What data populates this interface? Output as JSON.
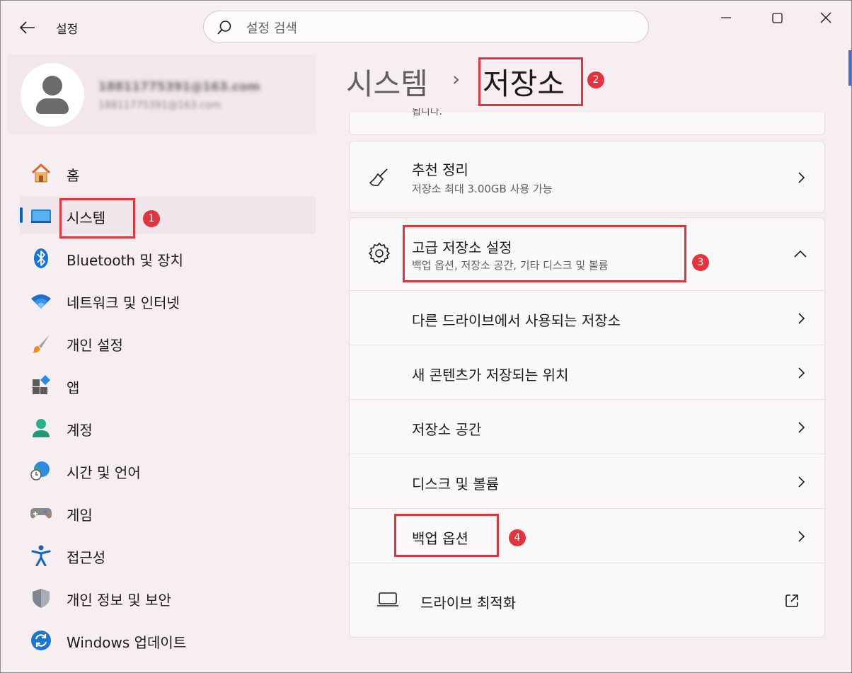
{
  "titlebar": {
    "app_title": "설정",
    "search_placeholder": "설정 검색"
  },
  "profile": {
    "name": "18811775391@163.com",
    "email": "18811775391@163.com"
  },
  "nav": {
    "items": [
      {
        "label": "홈",
        "icon": "home-icon"
      },
      {
        "label": "시스템",
        "icon": "system-icon",
        "selected": true
      },
      {
        "label": "Bluetooth 및 장치",
        "icon": "bluetooth-icon"
      },
      {
        "label": "네트워크 및 인터넷",
        "icon": "wifi-icon"
      },
      {
        "label": "개인 설정",
        "icon": "brush-icon"
      },
      {
        "label": "앱",
        "icon": "apps-icon"
      },
      {
        "label": "계정",
        "icon": "account-icon"
      },
      {
        "label": "시간 및 언어",
        "icon": "globe-clock-icon"
      },
      {
        "label": "게임",
        "icon": "gamepad-icon"
      },
      {
        "label": "접근성",
        "icon": "accessibility-icon"
      },
      {
        "label": "개인 정보 및 보안",
        "icon": "shield-icon"
      },
      {
        "label": "Windows 업데이트",
        "icon": "update-icon"
      }
    ]
  },
  "header": {
    "parent": "시스템",
    "separator": "›",
    "current": "저장소"
  },
  "main": {
    "clipped_text": "됩니다.",
    "cleanup": {
      "title": "추천 정리",
      "subtitle": "저장소 최대 3.00GB 사용 가능"
    },
    "advanced": {
      "title": "고급 저장소 설정",
      "subtitle": "백업 옵션, 저장소 공간, 기타 디스크 및 볼륨",
      "sub_items": [
        "다른 드라이브에서 사용되는 저장소",
        "새 콘텐츠가 저장되는 위치",
        "저장소 공간",
        "디스크 및 볼륨",
        "백업 옵션"
      ],
      "optimize": "드라이브 최적화"
    }
  },
  "annotations": [
    "1",
    "2",
    "3",
    "4"
  ],
  "colors": {
    "accent": "#0067c0",
    "annotation_red": "#e3343d",
    "window_bg": "#f7eef2",
    "card_bg": "#fbf8fa"
  }
}
